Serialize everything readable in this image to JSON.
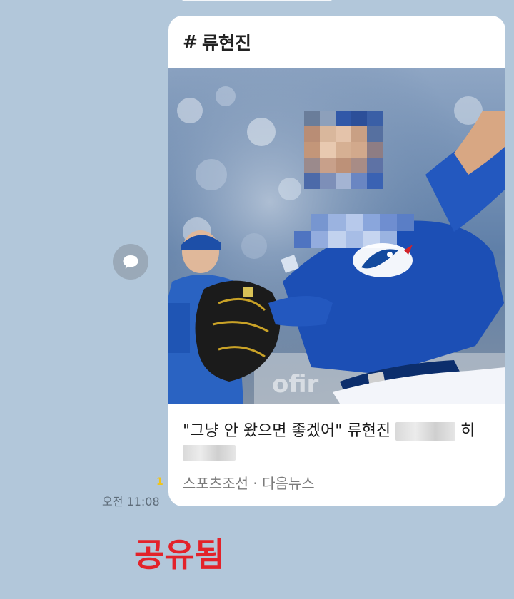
{
  "card": {
    "hashtag": "#",
    "topic": "류현진",
    "title_part1": "\"그냥 안 왔으면 좋겠어\" 류현진",
    "title_part2": "히",
    "source": "스포츠조선 · 다음뉴스"
  },
  "message_meta": {
    "unread_count": "1",
    "time": "오전 11:08"
  },
  "overlay": {
    "shared_label": "공유됨"
  },
  "colors": {
    "chat_background": "#b2c7da",
    "card_background": "#ffffff",
    "jersey_blue": "#1c4fb5",
    "annotation_red": "#e3222a",
    "unread_yellow": "#f0c419"
  },
  "icons": {
    "share": "speech-bubble-icon"
  }
}
